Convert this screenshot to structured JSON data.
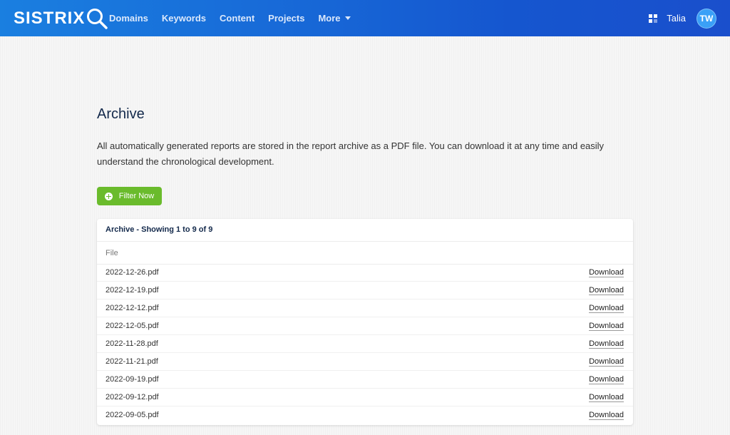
{
  "brand": {
    "name": "SISTRIX"
  },
  "nav": {
    "items": [
      {
        "label": "Domains"
      },
      {
        "label": "Keywords"
      },
      {
        "label": "Content"
      },
      {
        "label": "Projects"
      },
      {
        "label": "More"
      }
    ]
  },
  "user": {
    "name": "Talia",
    "initials": "TW"
  },
  "page": {
    "title": "Archive",
    "intro": "All automatically generated reports are stored in the report archive as a PDF file. You can download it at any time and easily understand the chronological development.",
    "filter_label": "Filter Now"
  },
  "archive": {
    "title": "Archive - Showing 1 to 9 of 9",
    "column": "File",
    "download_label": "Download",
    "files": [
      "2022-12-26.pdf",
      "2022-12-19.pdf",
      "2022-12-12.pdf",
      "2022-12-05.pdf",
      "2022-11-28.pdf",
      "2022-11-21.pdf",
      "2022-09-19.pdf",
      "2022-09-12.pdf",
      "2022-09-05.pdf"
    ]
  }
}
